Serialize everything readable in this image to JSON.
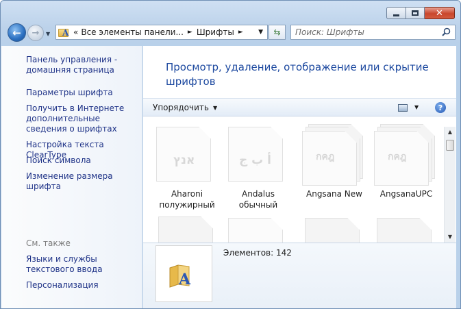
{
  "window": {
    "caption": {
      "min_icon": "minimize-icon",
      "max_icon": "maximize-icon",
      "close_glyph": "✕"
    }
  },
  "nav": {
    "back_glyph": "←",
    "forward_glyph": "→",
    "history_glyph": "▼"
  },
  "address": {
    "chevron": "«",
    "segments": [
      "Все элементы панели...",
      "Шрифты"
    ],
    "separator": "►",
    "dropdown": "▼",
    "refresh_glyph": "⇆"
  },
  "search": {
    "placeholder": "Поиск: Шрифты"
  },
  "sidebar": {
    "links": [
      {
        "label": "Панель управления - домашняя страница"
      },
      {
        "label": "Параметры шрифта"
      },
      {
        "label": "Получить в Интернете дополнительные сведения о шрифтах"
      },
      {
        "label": "Настройка текста ClearType"
      },
      {
        "label": "Поиск символа"
      },
      {
        "label": "Изменение размера шрифта"
      }
    ],
    "see_also_title": "См. также",
    "see_also": [
      {
        "label": "Языки и службы текстового ввода"
      },
      {
        "label": "Персонализация"
      }
    ]
  },
  "main": {
    "heading": "Просмотр, удаление, отображение или скрытие шрифтов",
    "toolbar": {
      "organize": "Упорядочить",
      "organize_arrow": "▼",
      "view_arrow": "▼",
      "help": "?"
    },
    "fonts": [
      {
        "name": "Aharoni полужирный",
        "sample": "אנץ",
        "stacked": false
      },
      {
        "name": "Andalus обычный",
        "sample": "أ ب ج",
        "stacked": false
      },
      {
        "name": "Angsana New",
        "sample": "กคฎ",
        "stacked": true
      },
      {
        "name": "AngsanaUPC",
        "sample": "กคฎ",
        "stacked": true
      }
    ],
    "scroll": {
      "up": "▲",
      "down": "▼"
    }
  },
  "details": {
    "count_text": "Элементов: 142"
  },
  "colors": {
    "link": "#1e3287",
    "heading": "#1e4aa0",
    "frame": "#b9d1ea"
  }
}
